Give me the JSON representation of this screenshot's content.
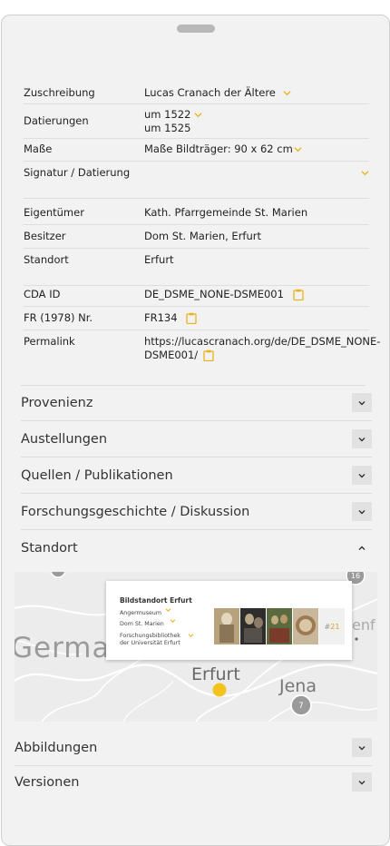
{
  "details": {
    "attribution_label": "Zuschreibung",
    "attribution_value": "Lucas Cranach der Ältere",
    "dating_label": "Datierungen",
    "dating_value_1": "um 1522",
    "dating_value_2": "um 1525",
    "dimensions_label": "Maße",
    "dimensions_value": "Maße Bildträger: 90 x 62 cm",
    "signature_label": "Signatur / Datierung",
    "owner_label": "Eigentümer",
    "owner_value": "Kath. Pfarrgemeinde St. Marien",
    "possessor_label": "Besitzer",
    "possessor_value": "Dom St. Marien, Erfurt",
    "location_label": "Standort",
    "location_value": "Erfurt",
    "cda_label": "CDA ID",
    "cda_value": "DE_DSME_NONE-DSME001",
    "fr_label": "FR (1978) Nr.",
    "fr_value": "FR134",
    "permalink_label": "Permalink",
    "permalink_value_1": "https://lucascranach.org/de/DE_DSME_NONE-",
    "permalink_value_2": "DSME001/"
  },
  "sections": {
    "provenance": "Provenienz",
    "exhibitions": "Austellungen",
    "sources": "Quellen / Publikationen",
    "research": "Forschungsgeschichte / Diskussion",
    "location": "Standort",
    "images": "Abbildungen",
    "versions": "Versionen"
  },
  "map": {
    "label_germany": "Germa",
    "label_erfurt": "Erfurt",
    "label_jena": "Jena",
    "label_cut": "enf",
    "cluster_top": "16",
    "cluster_jena": "7",
    "popup_title": "Bildstandort Erfurt",
    "popup_item_1": "Angermuseum",
    "popup_item_2": "Dom St. Marien",
    "popup_item_3a": "Forschungsbibliothek",
    "popup_item_3b": "der Universität Erfurt",
    "popup_more": "21"
  },
  "colors": {
    "accent": "#e9b21b",
    "background": "#f2f2f2",
    "button": "#e2e2e2"
  }
}
